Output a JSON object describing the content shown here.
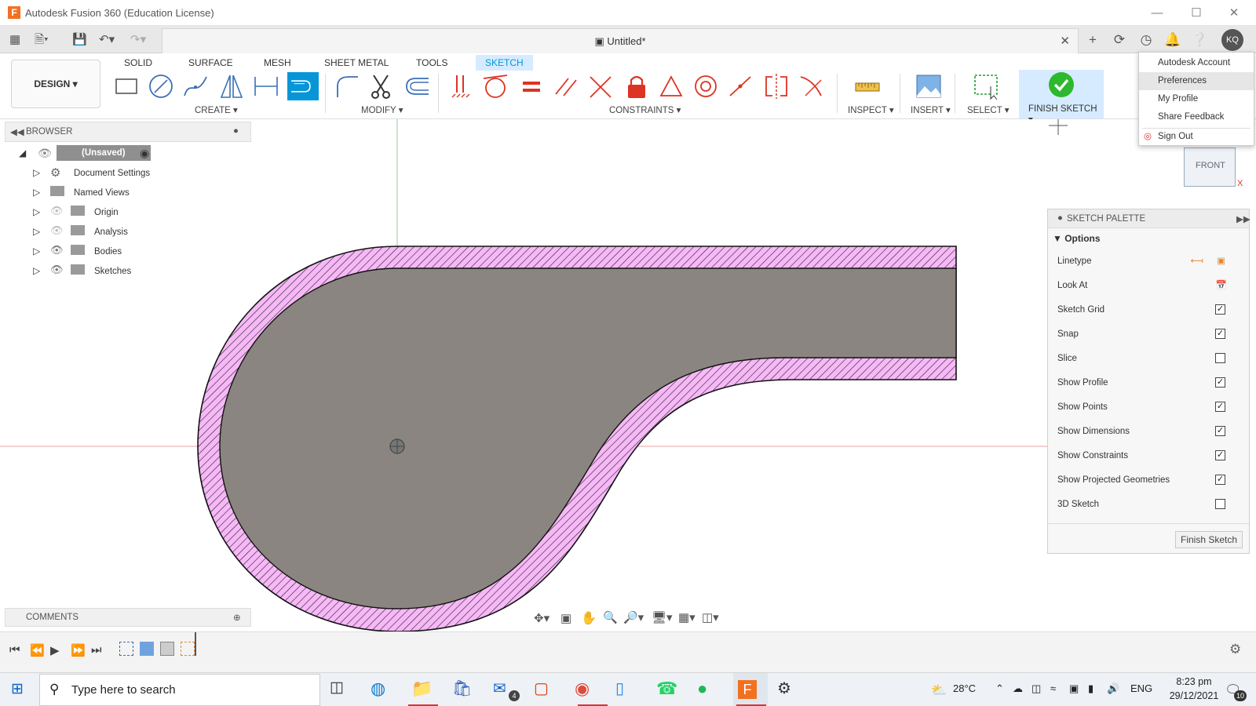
{
  "window": {
    "title": "Autodesk Fusion 360 (Education License)",
    "app_icon_letter": "F"
  },
  "document": {
    "tab_title": "Untitled*"
  },
  "user": {
    "initials": "KQ"
  },
  "workspace": {
    "label": "DESIGN"
  },
  "ribbon": {
    "tabs": [
      "SOLID",
      "SURFACE",
      "MESH",
      "SHEET METAL",
      "TOOLS",
      "SKETCH"
    ],
    "active_tab": "SKETCH",
    "groups": {
      "create": "CREATE",
      "modify": "MODIFY",
      "constraints": "CONSTRAINTS",
      "inspect": "INSPECT",
      "insert": "INSERT",
      "select": "SELECT",
      "finish": "FINISH SKETCH"
    }
  },
  "browser": {
    "title": "BROWSER",
    "root": "(Unsaved)",
    "items": [
      "Document Settings",
      "Named Views",
      "Origin",
      "Analysis",
      "Bodies",
      "Sketches"
    ]
  },
  "comments": {
    "title": "COMMENTS"
  },
  "profile_menu": {
    "items": [
      "Autodesk Account",
      "Preferences",
      "My Profile",
      "Share Feedback",
      "Sign Out"
    ],
    "highlighted": "Preferences"
  },
  "viewcube": {
    "face": "FRONT",
    "axis": "X"
  },
  "sketch_palette": {
    "title": "SKETCH PALETTE",
    "section": "Options",
    "rows": [
      {
        "label": "Linetype"
      },
      {
        "label": "Look At"
      },
      {
        "label": "Sketch Grid",
        "checked": true
      },
      {
        "label": "Snap",
        "checked": true
      },
      {
        "label": "Slice",
        "checked": false
      },
      {
        "label": "Show Profile",
        "checked": true
      },
      {
        "label": "Show Points",
        "checked": true
      },
      {
        "label": "Show Dimensions",
        "checked": true
      },
      {
        "label": "Show Constraints",
        "checked": true
      },
      {
        "label": "Show Projected Geometries",
        "checked": true
      },
      {
        "label": "3D Sketch",
        "checked": false
      }
    ],
    "finish_button": "Finish Sketch"
  },
  "taskbar": {
    "search_placeholder": "Type here to search",
    "weather": "28°C",
    "language": "ENG",
    "time": "8:23 pm",
    "date": "29/12/2021",
    "mail_badge": "4",
    "notif_badge": "10"
  },
  "colors": {
    "accent": "#0696d7",
    "hatch_fill": "#f7b8f7",
    "profile_fill": "#8a8580",
    "finish_green": "#2db82d"
  }
}
